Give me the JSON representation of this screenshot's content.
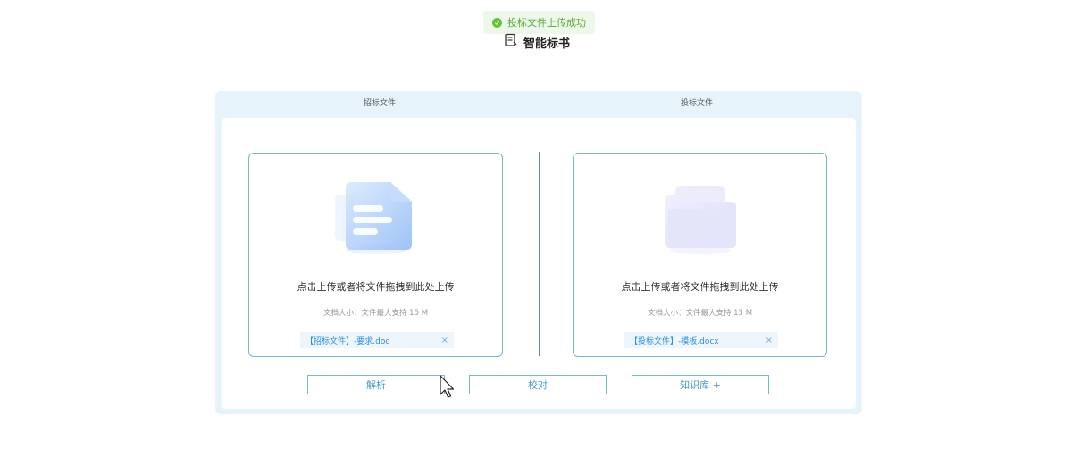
{
  "toast": {
    "message": "投标文件上传成功",
    "icon": "check-circle-icon",
    "color": "#67c23a"
  },
  "header": {
    "title": "智能标书",
    "icon": "document-icon"
  },
  "panels": {
    "left": {
      "tab_label": "招标文件",
      "upload_title": "点击上传或者将文件拖拽到此处上传",
      "upload_hint": "文档大小：文件最大支持 15 M",
      "file_name": "【招标文件】-要求.doc",
      "remove_label": "×",
      "illustration": "document-illustration"
    },
    "right": {
      "tab_label": "投标文件",
      "upload_title": "点击上传或者将文件拖拽到此处上传",
      "upload_hint": "文档大小：文件最大支持 15 M",
      "file_name": "【投标文件】-模板.docx",
      "remove_label": "×",
      "illustration": "folder-illustration"
    }
  },
  "actions": {
    "parse": "解析",
    "check": "校对",
    "knowledge": "知识库 +"
  },
  "colors": {
    "accent": "#2d8cd6",
    "panel_bg": "#e6f3fb",
    "border": "#7cb5cd"
  }
}
